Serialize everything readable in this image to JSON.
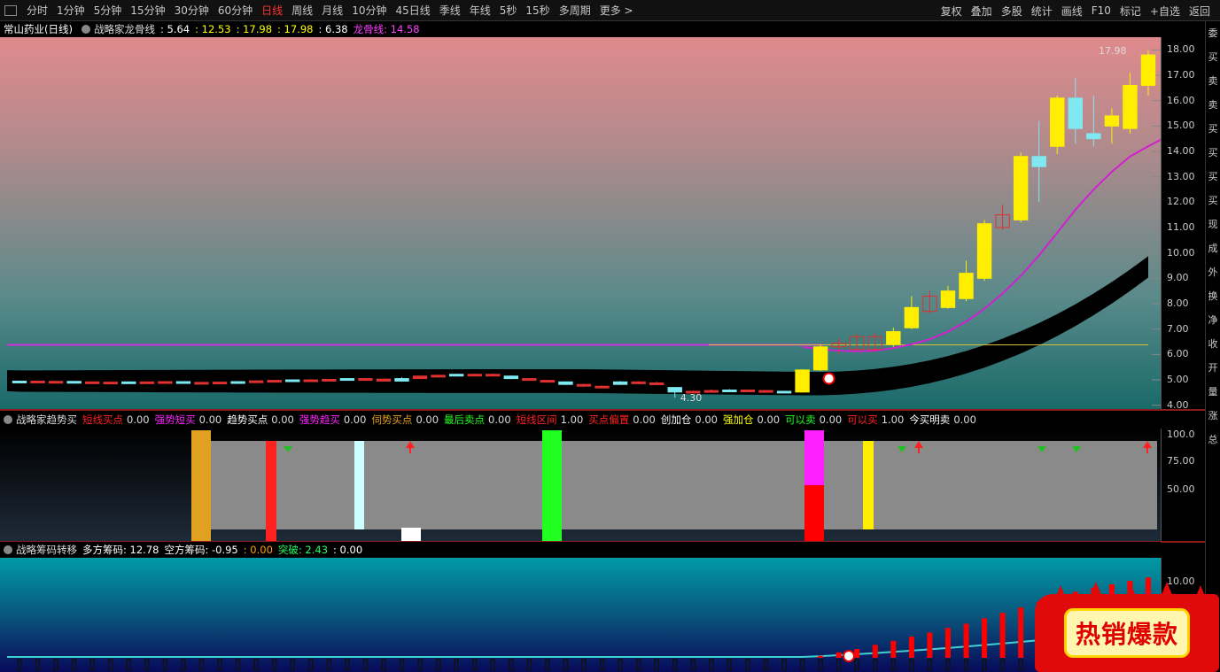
{
  "toolbar": {
    "periods": [
      "分时",
      "1分钟",
      "5分钟",
      "15分钟",
      "30分钟",
      "60分钟",
      "日线",
      "周线",
      "月线",
      "10分钟",
      "45日线",
      "季线",
      "年线",
      "5秒",
      "15秒",
      "多周期",
      "更多 >"
    ],
    "active_period": "日线",
    "tools": [
      "复权",
      "叠加",
      "多股",
      "统计",
      "画线",
      "F10",
      "标记",
      "+自选",
      "返回"
    ]
  },
  "main_panel": {
    "stock_name": "常山药业(日线)",
    "indicator_name": "战略家龙骨线",
    "values": [
      ": 5.64",
      ": 12.53",
      ": 17.98",
      ": 17.98",
      ": 6.38"
    ],
    "value_colors": [
      "#ffffff",
      "#ffff00",
      "#ffff00",
      "#ffff00",
      "#ffffff"
    ],
    "dragon_label": "龙骨线",
    "dragon_value": ": 14.58",
    "high_label": "17.98",
    "low_label": "4.30",
    "y_ticks": [
      "18.00",
      "17.00",
      "16.00",
      "15.00",
      "14.00",
      "13.00",
      "12.00",
      "11.00",
      "10.00",
      "9.00",
      "8.00",
      "7.00",
      "6.00",
      "5.00",
      "4.00"
    ],
    "candles": [
      {
        "o": 4.95,
        "c": 4.95,
        "h": 4.97,
        "l": 4.93
      },
      {
        "o": 4.95,
        "c": 4.93,
        "h": 4.97,
        "l": 4.92
      },
      {
        "o": 4.93,
        "c": 4.94,
        "h": 4.96,
        "l": 4.91
      },
      {
        "o": 4.94,
        "c": 4.92,
        "h": 4.95,
        "l": 4.9
      },
      {
        "o": 4.92,
        "c": 4.91,
        "h": 4.94,
        "l": 4.89
      },
      {
        "o": 4.91,
        "c": 4.9,
        "h": 4.93,
        "l": 4.88
      },
      {
        "o": 4.9,
        "c": 4.92,
        "h": 4.94,
        "l": 4.89
      },
      {
        "o": 4.92,
        "c": 4.91,
        "h": 4.93,
        "l": 4.9
      },
      {
        "o": 4.91,
        "c": 4.93,
        "h": 4.95,
        "l": 4.9
      },
      {
        "o": 4.93,
        "c": 4.9,
        "h": 4.94,
        "l": 4.88
      },
      {
        "o": 4.9,
        "c": 4.89,
        "h": 4.92,
        "l": 4.87
      },
      {
        "o": 4.89,
        "c": 4.91,
        "h": 4.93,
        "l": 4.88
      },
      {
        "o": 4.91,
        "c": 4.93,
        "h": 4.95,
        "l": 4.9
      },
      {
        "o": 4.93,
        "c": 4.96,
        "h": 4.98,
        "l": 4.92
      },
      {
        "o": 4.96,
        "c": 4.98,
        "h": 5.0,
        "l": 4.95
      },
      {
        "o": 4.98,
        "c": 5.0,
        "h": 5.02,
        "l": 4.97
      },
      {
        "o": 5.0,
        "c": 4.99,
        "h": 5.03,
        "l": 4.97
      },
      {
        "o": 4.99,
        "c": 5.02,
        "h": 5.04,
        "l": 4.98
      },
      {
        "o": 5.02,
        "c": 5.05,
        "h": 5.07,
        "l": 5.01
      },
      {
        "o": 5.05,
        "c": 5.03,
        "h": 5.08,
        "l": 5.02
      },
      {
        "o": 5.03,
        "c": 4.95,
        "h": 5.05,
        "l": 4.93
      },
      {
        "o": 4.95,
        "c": 5.05,
        "h": 5.1,
        "l": 4.94
      },
      {
        "o": 5.05,
        "c": 5.15,
        "h": 5.18,
        "l": 5.04
      },
      {
        "o": 5.15,
        "c": 5.18,
        "h": 5.2,
        "l": 5.14
      },
      {
        "o": 5.18,
        "c": 5.22,
        "h": 5.24,
        "l": 5.16
      },
      {
        "o": 5.22,
        "c": 5.18,
        "h": 5.25,
        "l": 5.16
      },
      {
        "o": 5.18,
        "c": 5.22,
        "h": 5.25,
        "l": 5.17
      },
      {
        "o": 5.15,
        "c": 5.05,
        "h": 5.17,
        "l": 5.03
      },
      {
        "o": 5.05,
        "c": 4.98,
        "h": 5.07,
        "l": 4.96
      },
      {
        "o": 4.98,
        "c": 4.92,
        "h": 5.0,
        "l": 4.9
      },
      {
        "o": 4.92,
        "c": 4.82,
        "h": 4.94,
        "l": 4.8
      },
      {
        "o": 4.82,
        "c": 4.75,
        "h": 4.85,
        "l": 4.72
      },
      {
        "o": 4.75,
        "c": 4.7,
        "h": 4.78,
        "l": 4.68
      },
      {
        "o": 4.82,
        "c": 4.92,
        "h": 4.95,
        "l": 4.8
      },
      {
        "o": 4.92,
        "c": 4.85,
        "h": 4.95,
        "l": 4.82
      },
      {
        "o": 4.88,
        "c": 4.85,
        "h": 4.92,
        "l": 4.8
      },
      {
        "o": 4.7,
        "c": 4.52,
        "h": 4.72,
        "l": 4.3
      },
      {
        "o": 4.52,
        "c": 4.55,
        "h": 4.58,
        "l": 4.48
      },
      {
        "o": 4.55,
        "c": 4.58,
        "h": 4.62,
        "l": 4.53
      },
      {
        "o": 4.58,
        "c": 4.6,
        "h": 4.63,
        "l": 4.56
      },
      {
        "o": 4.6,
        "c": 4.58,
        "h": 4.62,
        "l": 4.56
      },
      {
        "o": 4.58,
        "c": 4.55,
        "h": 4.6,
        "l": 4.52
      },
      {
        "o": 4.55,
        "c": 4.52,
        "h": 4.57,
        "l": 4.5
      },
      {
        "o": 4.52,
        "c": 5.39,
        "h": 5.42,
        "l": 4.5
      },
      {
        "o": 5.39,
        "c": 6.3,
        "h": 6.4,
        "l": 5.35
      },
      {
        "o": 6.3,
        "c": 6.45,
        "h": 6.65,
        "l": 6.0
      },
      {
        "o": 6.2,
        "c": 6.7,
        "h": 6.8,
        "l": 6.15
      },
      {
        "o": 6.2,
        "c": 6.7,
        "h": 6.85,
        "l": 6.1
      },
      {
        "o": 6.4,
        "c": 6.9,
        "h": 7.05,
        "l": 6.3
      },
      {
        "o": 7.05,
        "c": 7.85,
        "h": 8.3,
        "l": 7.0
      },
      {
        "o": 7.7,
        "c": 8.3,
        "h": 8.5,
        "l": 7.6
      },
      {
        "o": 7.85,
        "c": 8.5,
        "h": 8.7,
        "l": 7.8
      },
      {
        "o": 8.2,
        "c": 9.2,
        "h": 9.7,
        "l": 8.1
      },
      {
        "o": 9.0,
        "c": 11.15,
        "h": 11.3,
        "l": 8.9
      },
      {
        "o": 11.0,
        "c": 11.5,
        "h": 11.9,
        "l": 10.9
      },
      {
        "o": 11.3,
        "c": 13.8,
        "h": 13.95,
        "l": 11.2
      },
      {
        "o": 13.8,
        "c": 13.4,
        "h": 15.2,
        "l": 12.0
      },
      {
        "o": 14.2,
        "c": 16.1,
        "h": 16.2,
        "l": 13.9
      },
      {
        "o": 16.1,
        "c": 14.9,
        "h": 16.9,
        "l": 14.3
      },
      {
        "o": 14.7,
        "c": 14.5,
        "h": 16.2,
        "l": 14.2
      },
      {
        "o": 15.0,
        "c": 15.4,
        "h": 15.7,
        "l": 14.3
      },
      {
        "o": 14.9,
        "c": 16.6,
        "h": 17.1,
        "l": 14.7
      },
      {
        "o": 16.6,
        "c": 17.8,
        "h": 17.98,
        "l": 16.2
      }
    ],
    "dragon_line": [
      6.38,
      6.38,
      6.38,
      6.38,
      6.38,
      6.38,
      6.38,
      6.38,
      6.38,
      6.38,
      6.38,
      6.38,
      6.38,
      6.38,
      6.38,
      6.38,
      6.38,
      6.38,
      6.38,
      6.38,
      6.38,
      6.38,
      6.38,
      6.38,
      6.38,
      6.38,
      6.38,
      6.38,
      6.38,
      6.38,
      6.38,
      6.38,
      6.38,
      6.38,
      6.38,
      6.38,
      6.38,
      6.38,
      6.38,
      6.38,
      6.38,
      6.38,
      6.38,
      6.3,
      6.2,
      6.15,
      6.12,
      6.15,
      6.25,
      6.4,
      6.6,
      6.9,
      7.3,
      7.8,
      8.4,
      9.1,
      9.9,
      10.8,
      11.7,
      12.5,
      13.2,
      13.8,
      14.2,
      14.58
    ]
  },
  "trend_panel": {
    "name": "战略家趋势买",
    "items": [
      {
        "label": "短线买点",
        "value": "0.00",
        "color": "#ff2020"
      },
      {
        "label": "强势短买",
        "value": "0.00",
        "color": "#ff20ff"
      },
      {
        "label": "趋势买点",
        "value": "0.00",
        "color": "#ffffff"
      },
      {
        "label": "强势趋买",
        "value": "0.00",
        "color": "#ff20ff"
      },
      {
        "label": "伺势买点",
        "value": "0.00",
        "color": "#e0a020"
      },
      {
        "label": "最后卖点",
        "value": "0.00",
        "color": "#20ff20"
      },
      {
        "label": "短线区间",
        "value": "1.00",
        "color": "#ff2020"
      },
      {
        "label": "买点偏置",
        "value": "0.00",
        "color": "#ff2020"
      },
      {
        "label": "创加仓",
        "value": "0.00",
        "color": "#ffffff"
      },
      {
        "label": "强加仓",
        "value": "0.00",
        "color": "#ffff00"
      },
      {
        "label": "可以卖",
        "value": "0.00",
        "color": "#20ff20"
      },
      {
        "label": "可以买",
        "value": "1.00",
        "color": "#ff2020"
      },
      {
        "label": "今买明卖",
        "value": "0.00",
        "color": "#ffffff"
      }
    ],
    "y_ticks": [
      "100.0",
      "75.00",
      "50.00"
    ]
  },
  "chip_panel": {
    "name": "战略筹码转移",
    "long_label": "多方筹码",
    "long_value": ": 12.78",
    "short_label": "空方筹码",
    "short_value": ": -0.95",
    "extra_value": ": 0.00",
    "breakout_label": "突破",
    "breakout_value": ": 2.43",
    "last_value": ": 0.00",
    "y_ticks": [
      "10.00"
    ],
    "bars": [
      0.3,
      0.8,
      1.3,
      1.9,
      2.5,
      3.1,
      3.7,
      4.4,
      5.0,
      5.8,
      6.6,
      7.4,
      8.2,
      9.0,
      9.7,
      10.3,
      10.8,
      11.3,
      11.8,
      12.2,
      12.5,
      12.78
    ]
  },
  "right_strip": [
    "委",
    "买",
    "卖",
    "卖",
    "买",
    "买",
    "买",
    "买",
    "现",
    "成",
    "外",
    "换",
    "净",
    "收",
    "开",
    "量",
    "涨",
    "总"
  ],
  "badge": {
    "text": "热销爆款"
  }
}
